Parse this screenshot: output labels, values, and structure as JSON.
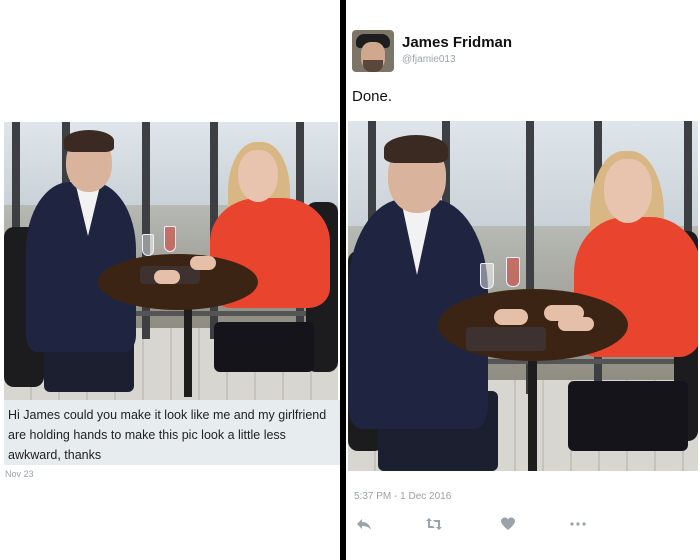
{
  "left": {
    "message_text": "Hi James could you make it look like me and my girlfriend are holding hands to make this pic look a little less awkward, thanks",
    "message_date": "Nov 23",
    "photo_icon": "couple-photo-icon"
  },
  "right": {
    "author_name": "James Fridman",
    "author_handle": "@fjamie013",
    "tweet_text": "Done.",
    "timestamp": "5:37 PM - 1 Dec 2016",
    "actions": {
      "reply": "reply-icon",
      "retweet": "retweet-icon",
      "like": "heart-icon",
      "more": "more-icon"
    }
  },
  "colors": {
    "background": "#000000",
    "card": "#ffffff",
    "message_bg": "#e7ecef",
    "muted_text": "#9aa3a9",
    "dress": "#e9452e",
    "suit": "#1f2540"
  }
}
